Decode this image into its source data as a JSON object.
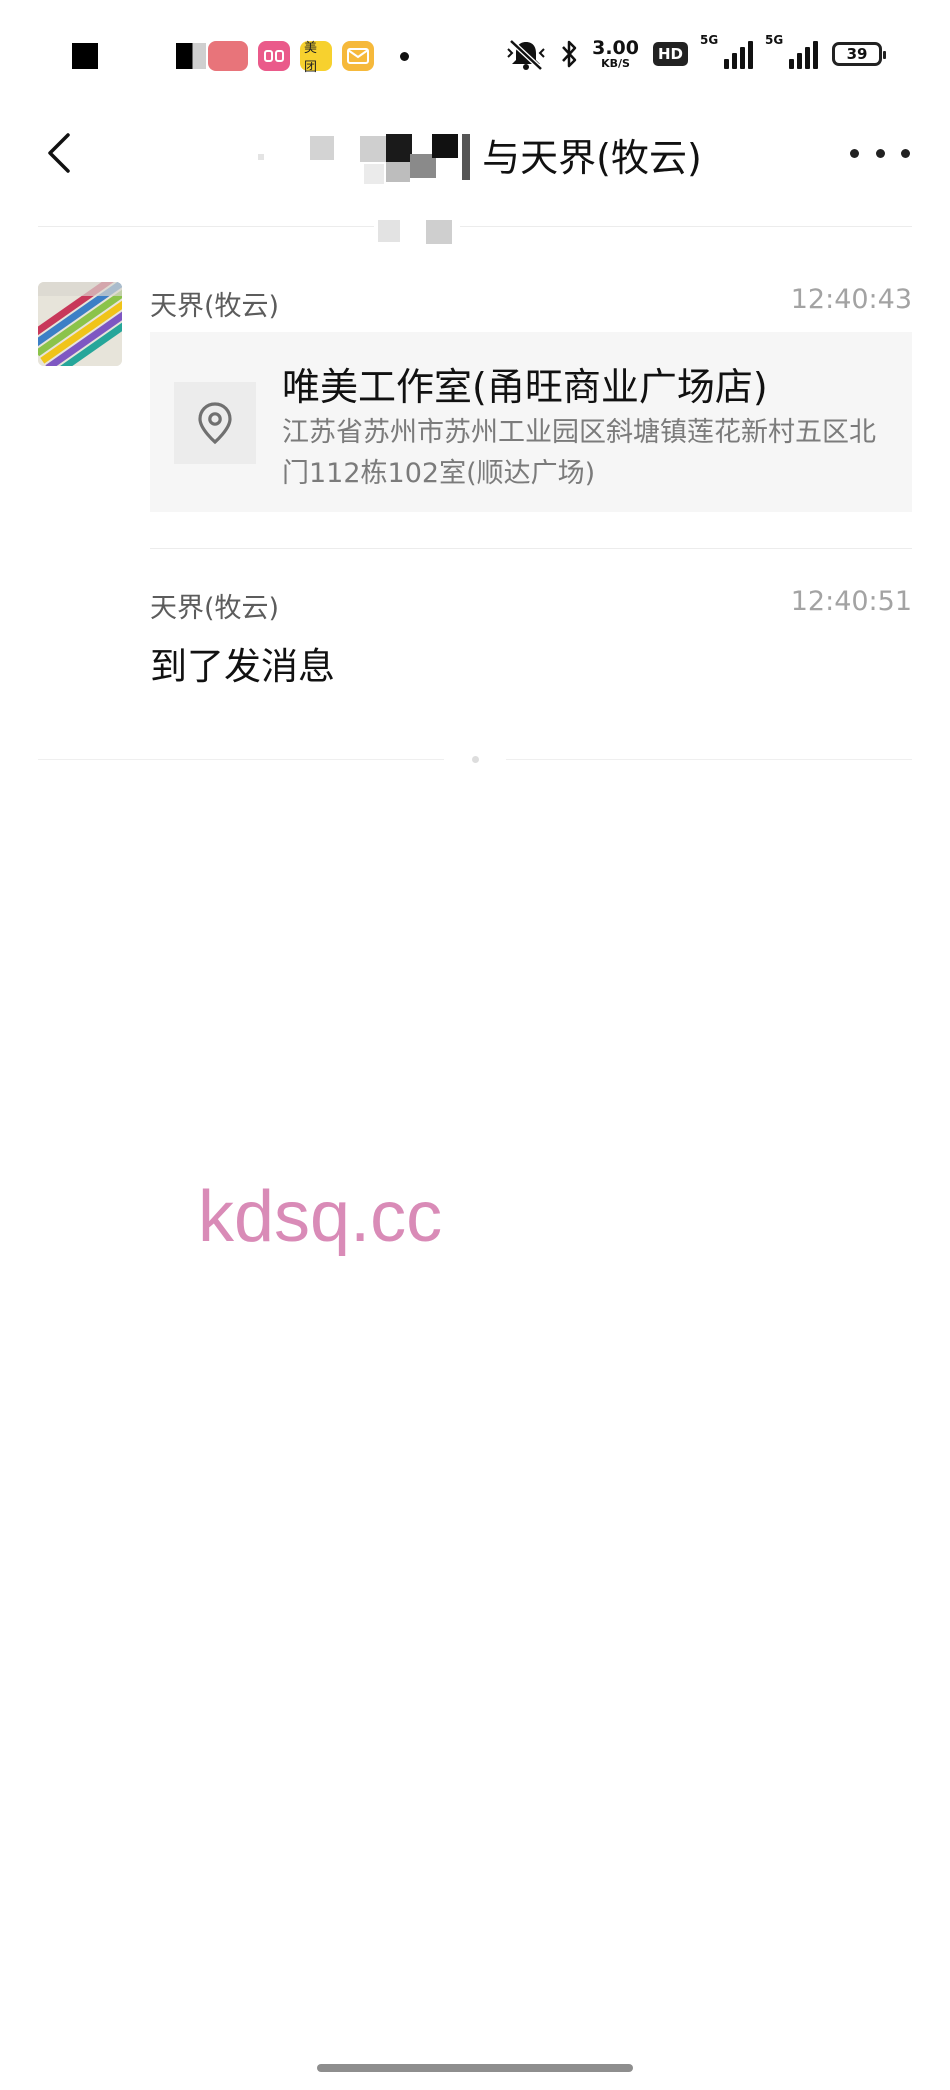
{
  "status_bar": {
    "app_icons": [
      "美团"
    ],
    "network_speed_value": "3.00",
    "network_speed_unit": "KB/S",
    "hd_badge": "HD",
    "sim1_label": "5G",
    "sim2_label": "5G",
    "battery": "39",
    "icons": [
      "mute-bell-icon",
      "bluetooth-icon",
      "signal-icon",
      "battery-icon"
    ]
  },
  "header": {
    "title": "与天界(牧云)",
    "icons": [
      "back-chevron-icon",
      "more-dots-icon"
    ]
  },
  "messages": [
    {
      "sender": "天界(牧云)",
      "time": "12:40:43",
      "type": "location",
      "location_name": "唯美工作室(甬旺商业广场店)",
      "location_address": "江苏省苏州市苏州工业园区斜塘镇莲花新村五区北门112栋102室(顺达广场)",
      "icon": "location-pin-icon"
    },
    {
      "sender": "天界(牧云)",
      "time": "12:40:51",
      "type": "text",
      "text": "到了发消息"
    }
  ],
  "watermark": "kdsq.cc",
  "colors": {
    "background": "#ffffff",
    "card": "#f6f6f6",
    "secondary_text": "#7b7b7b",
    "watermark": "#d98bb7"
  }
}
